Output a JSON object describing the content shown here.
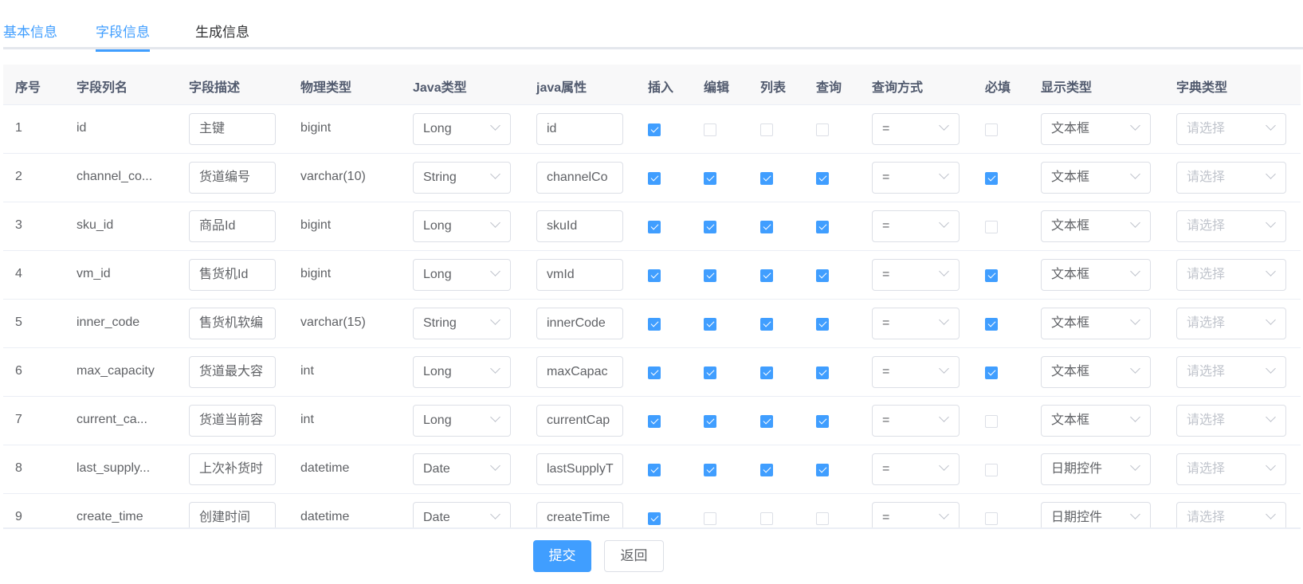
{
  "tabs": [
    {
      "label": "基本信息"
    },
    {
      "label": "字段信息"
    },
    {
      "label": "生成信息"
    }
  ],
  "active_tab": "字段信息",
  "columns": [
    "序号",
    "字段列名",
    "字段描述",
    "物理类型",
    "Java类型",
    "java属性",
    "插入",
    "编辑",
    "列表",
    "查询",
    "查询方式",
    "必填",
    "显示类型",
    "字典类型"
  ],
  "dict_placeholder": "请选择",
  "rows": [
    {
      "no": "1",
      "column": "id",
      "desc": "主键",
      "phys": "bigint",
      "java_type": "Long",
      "java_prop": "id",
      "insert": true,
      "edit": false,
      "list": false,
      "query": false,
      "query_type": "=",
      "required": false,
      "html_type": "文本框"
    },
    {
      "no": "2",
      "column": "channel_co...",
      "desc": "货道编号",
      "phys": "varchar(10)",
      "java_type": "String",
      "java_prop": "channelCo",
      "insert": true,
      "edit": true,
      "list": true,
      "query": true,
      "query_type": "=",
      "required": true,
      "html_type": "文本框"
    },
    {
      "no": "3",
      "column": "sku_id",
      "desc": "商品Id",
      "phys": "bigint",
      "java_type": "Long",
      "java_prop": "skuId",
      "insert": true,
      "edit": true,
      "list": true,
      "query": true,
      "query_type": "=",
      "required": false,
      "html_type": "文本框"
    },
    {
      "no": "4",
      "column": "vm_id",
      "desc": "售货机Id",
      "phys": "bigint",
      "java_type": "Long",
      "java_prop": "vmId",
      "insert": true,
      "edit": true,
      "list": true,
      "query": true,
      "query_type": "=",
      "required": true,
      "html_type": "文本框"
    },
    {
      "no": "5",
      "column": "inner_code",
      "desc": "售货机软编",
      "phys": "varchar(15)",
      "java_type": "String",
      "java_prop": "innerCode",
      "insert": true,
      "edit": true,
      "list": true,
      "query": true,
      "query_type": "=",
      "required": true,
      "html_type": "文本框"
    },
    {
      "no": "6",
      "column": "max_capacity",
      "desc": "货道最大容",
      "phys": "int",
      "java_type": "Long",
      "java_prop": "maxCapac",
      "insert": true,
      "edit": true,
      "list": true,
      "query": true,
      "query_type": "=",
      "required": true,
      "html_type": "文本框"
    },
    {
      "no": "7",
      "column": "current_ca...",
      "desc": "货道当前容",
      "phys": "int",
      "java_type": "Long",
      "java_prop": "currentCap",
      "insert": true,
      "edit": true,
      "list": true,
      "query": true,
      "query_type": "=",
      "required": false,
      "html_type": "文本框"
    },
    {
      "no": "8",
      "column": "last_supply...",
      "desc": "上次补货时",
      "phys": "datetime",
      "java_type": "Date",
      "java_prop": "lastSupplyT",
      "insert": true,
      "edit": true,
      "list": true,
      "query": true,
      "query_type": "=",
      "required": false,
      "html_type": "日期控件"
    },
    {
      "no": "9",
      "column": "create_time",
      "desc": "创建时间",
      "phys": "datetime",
      "java_type": "Date",
      "java_prop": "createTime",
      "insert": true,
      "edit": false,
      "list": false,
      "query": false,
      "query_type": "=",
      "required": false,
      "html_type": "日期控件"
    }
  ],
  "buttons": {
    "submit": "提交",
    "back": "返回"
  },
  "colors": {
    "accent": "#409eff"
  }
}
